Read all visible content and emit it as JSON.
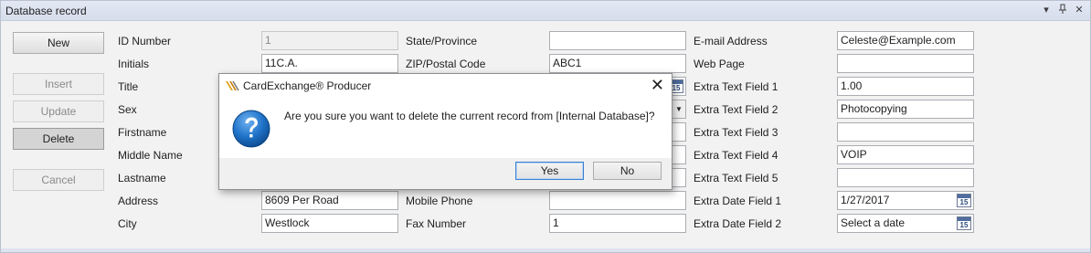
{
  "panel": {
    "title": "Database record",
    "icons": [
      "dropdown-arrow-icon",
      "pin-icon",
      "close-icon"
    ],
    "close_glyph": "✕",
    "pin_glyph": "⫽",
    "menu_glyph": "▾"
  },
  "buttons": {
    "new": "New",
    "insert": "Insert",
    "update": "Update",
    "delete": "Delete",
    "cancel": "Cancel"
  },
  "col1": {
    "id_label": "ID Number",
    "id_value": "1",
    "initials_label": "Initials",
    "initials_value": "11C.A.",
    "title_label": "Title",
    "sex_label": "Sex",
    "firstname_label": "Firstname",
    "middlename_label": "Middle Name",
    "lastname_label": "Lastname",
    "address_label": "Address",
    "address_value": "8609 Per Road",
    "city_label": "City",
    "city_value": "Westlock"
  },
  "col2": {
    "state_label": "State/Province",
    "state_value": "",
    "zip_label": "ZIP/Postal Code",
    "zip_value": "ABC1",
    "mobile_label": "Mobile Phone",
    "mobile_value": "",
    "fax_label": "Fax Number",
    "fax_value": "1"
  },
  "col3": {
    "email_label": "E-mail Address",
    "email_value": "Celeste@Example.com",
    "web_label": "Web Page",
    "web_value": "",
    "text1_label": "Extra Text Field 1",
    "text1_value": "1.00",
    "text2_label": "Extra Text Field 2",
    "text2_value": "Photocopying",
    "text3_label": "Extra Text Field 3",
    "text3_value": "",
    "text4_label": "Extra Text Field 4",
    "text4_value": "VOIP",
    "text5_label": "Extra Text Field 5",
    "text5_value": "",
    "date1_label": "Extra Date Field 1",
    "date1_value": "1/27/2017",
    "date2_label": "Extra Date Field 2",
    "date2_placeholder": "Select a date"
  },
  "calendar_day": "15",
  "dialog": {
    "title": "CardExchange® Producer",
    "message": "Are you sure you want to delete the current record from [Internal Database]?",
    "yes": "Yes",
    "no": "No",
    "close_glyph": "✕"
  },
  "colors": {
    "accent_blue": "#1f73c9",
    "focus_border": "#3c7fd1"
  }
}
